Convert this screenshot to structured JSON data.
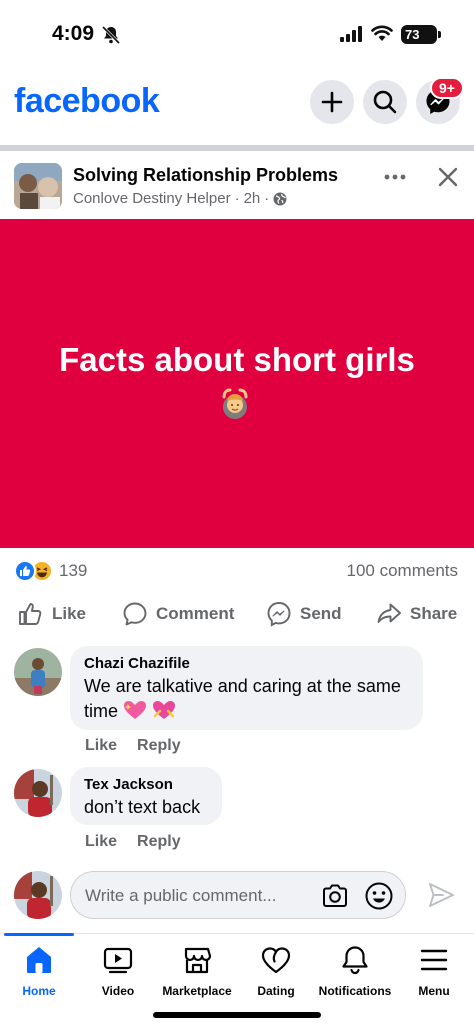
{
  "status_bar": {
    "time": "4:09",
    "battery": "73"
  },
  "header": {
    "logo": "facebook",
    "messenger_badge": "9+"
  },
  "post": {
    "group_name": "Solving Relationship Problems",
    "author": "Conlove Destiny Helper",
    "time": "2h",
    "image_text": "Facts about short girls",
    "image_bg": "#e0003f",
    "reaction_count": "139",
    "comments_count": "100 comments"
  },
  "actions": {
    "like": "Like",
    "comment": "Comment",
    "send": "Send",
    "share": "Share"
  },
  "comments": [
    {
      "name": "Chazi Chazifile",
      "text_line1": "We are talkative and caring at the same",
      "text_line2": "time",
      "like": "Like",
      "reply": "Reply"
    },
    {
      "name": "Tex Jackson",
      "text_line1": "don’t text back",
      "like": "Like",
      "reply": "Reply"
    }
  ],
  "write_comment": {
    "placeholder": "Write a public comment..."
  },
  "bottom_nav": {
    "home": "Home",
    "video": "Video",
    "marketplace": "Marketplace",
    "dating": "Dating",
    "notifications": "Notifications",
    "menu": "Menu"
  },
  "colors": {
    "brand": "#0866ff",
    "badge": "#e41e3f",
    "muted": "#65676b"
  }
}
